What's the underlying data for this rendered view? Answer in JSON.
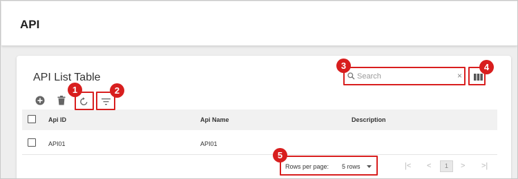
{
  "header": {
    "title": "API"
  },
  "card": {
    "title": "API List Table",
    "search": {
      "placeholder": "Search",
      "value": ""
    }
  },
  "toolbar": {
    "add_icon": "add-circle-icon",
    "delete_icon": "delete-icon",
    "refresh_icon": "refresh-icon",
    "filter_icon": "filter-icon",
    "columns_icon": "view-columns-icon"
  },
  "table": {
    "columns": [
      "Api ID",
      "Api Name",
      "Description"
    ],
    "rows": [
      {
        "api_id": "API01",
        "api_name": "API01",
        "description": ""
      }
    ]
  },
  "pagination": {
    "rows_per_page_label": "Rows per page:",
    "rows_per_page_value": "5 rows",
    "current_page": "1"
  },
  "annotations": [
    "1",
    "2",
    "3",
    "4",
    "5"
  ],
  "colors": {
    "highlight": "#d81e1e",
    "header_bg": "#f1f1f1"
  }
}
